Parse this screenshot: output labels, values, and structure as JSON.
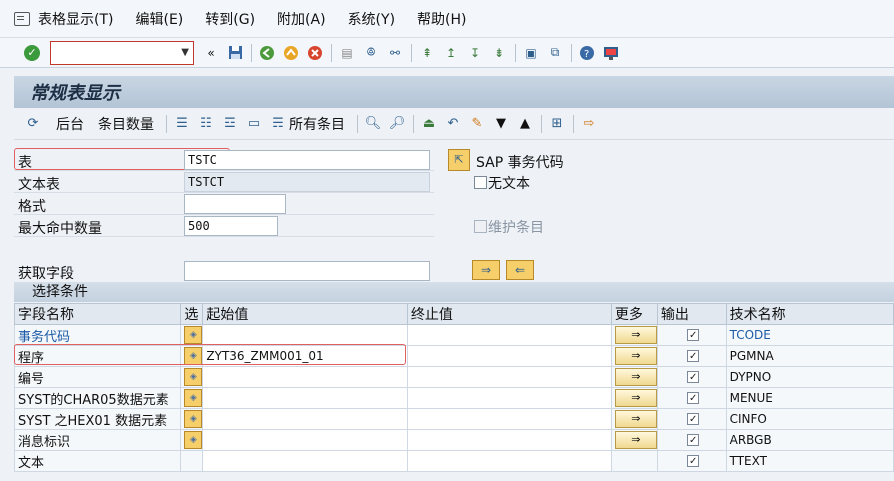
{
  "menu": [
    "表格显示(T)",
    "编辑(E)",
    "转到(G)",
    "附加(A)",
    "系统(Y)",
    "帮助(H)"
  ],
  "title": "常规表显示",
  "app_toolbar": {
    "back": "后台",
    "count": "条目数量",
    "all_entries": "所有条目"
  },
  "form": {
    "table_label": "表",
    "table_value": "TSTC",
    "text_table_label": "文本表",
    "text_table_value": "TSTCT",
    "format_label": "格式",
    "format_value": "",
    "max_hits_label": "最大命中数量",
    "max_hits_value": "500",
    "get_fields_label": "获取字段",
    "get_fields_value": "",
    "sap_tcode_label": "SAP 事务代码",
    "no_text_label": "无文本",
    "maintain_label": "维护条目"
  },
  "selection": {
    "header": "选择条件",
    "columns": [
      "字段名称",
      "选",
      "起始值",
      "终止值",
      "更多",
      "输出",
      "技术名称"
    ],
    "rows": [
      {
        "name": "事务代码",
        "from": "",
        "to": "",
        "output": true,
        "tech": "TCODE",
        "highlight": true
      },
      {
        "name": "程序",
        "from": "ZYT36_ZMM001_01",
        "to": "",
        "output": true,
        "tech": "PGMNA"
      },
      {
        "name": "编号",
        "from": "",
        "to": "",
        "output": true,
        "tech": "DYPNO"
      },
      {
        "name": "SYST的CHAR05数据元素",
        "from": "",
        "to": "",
        "output": true,
        "tech": "MENUE"
      },
      {
        "name": "SYST 之HEX01 数据元素",
        "from": "",
        "to": "",
        "output": true,
        "tech": "CINFO"
      },
      {
        "name": "消息标识",
        "from": "",
        "to": "",
        "output": true,
        "tech": "ARBGB"
      },
      {
        "name": "文本",
        "from": "",
        "to": "",
        "output": true,
        "tech": "TTEXT"
      }
    ]
  }
}
